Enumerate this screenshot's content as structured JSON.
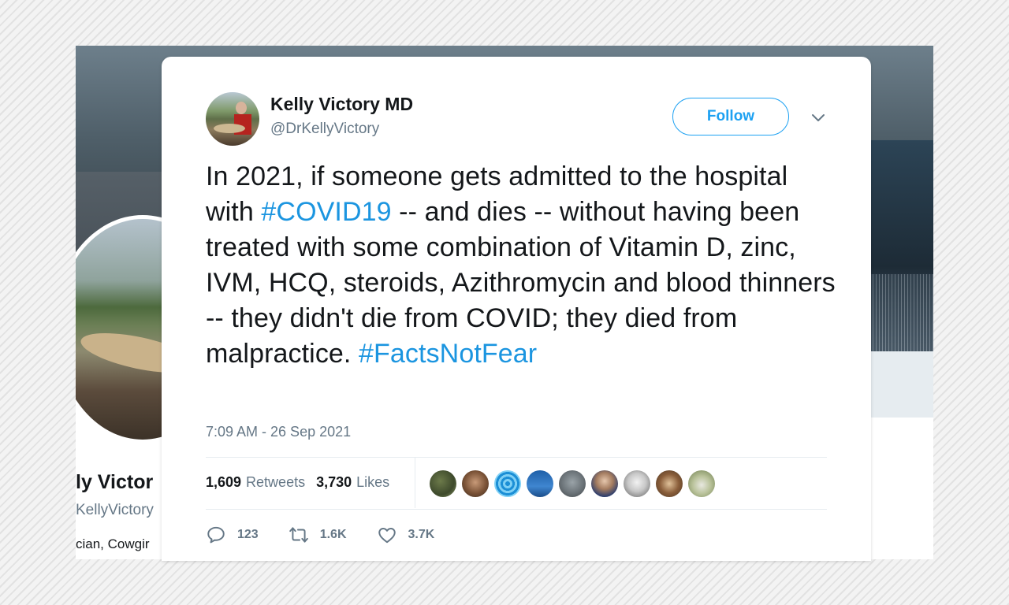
{
  "background_profile": {
    "name_fragment": "ly Victor",
    "handle_fragment": "KellyVictory",
    "bio_fragment": "cian, Cowgir"
  },
  "tweet": {
    "author": {
      "display_name": "Kelly Victory MD",
      "screen_name": "@DrKellyVictory"
    },
    "follow_label": "Follow",
    "text_parts": {
      "p1": "In 2021, if someone gets admitted to the hospital with ",
      "hashtag1": "#COVID19",
      "p2": " -- and dies -- without having been treated with some combination of Vitamin D, zinc, IVM, HCQ, steroids, Azithromycin and blood thinners -- they didn't die from COVID; they died from malpractice. ",
      "hashtag2": "#FactsNotFear"
    },
    "timestamp": "7:09 AM - 26 Sep 2021",
    "stats": {
      "retweets_count": "1,609",
      "retweets_label": "Retweets",
      "likes_count": "3,730",
      "likes_label": "Likes"
    },
    "actions": {
      "reply_count": "123",
      "retweet_count": "1.6K",
      "like_count": "3.7K"
    },
    "icons": {
      "reply": "reply-icon",
      "retweet": "retweet-icon",
      "like": "heart-icon",
      "caret": "chevron-down-icon"
    }
  },
  "colors": {
    "link_blue": "#1b95e0",
    "follow_blue": "#1da1f2",
    "text_dark": "#14171a",
    "text_gray": "#657786"
  }
}
